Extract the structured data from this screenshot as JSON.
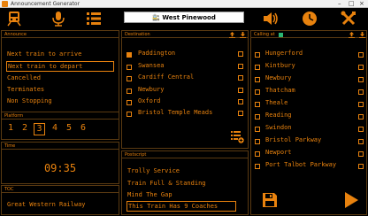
{
  "window": {
    "title": "Announcement Generator"
  },
  "toolbar": {
    "station": "West Pinewood"
  },
  "announce": {
    "header": "Announce",
    "items": [
      "Next train to arrive",
      "Next train to depart",
      "Cancelled",
      "Terminates",
      "Non Stopping"
    ],
    "selected_index": 1
  },
  "platform": {
    "header": "Platform",
    "numbers": [
      "1",
      "2",
      "3",
      "4",
      "5",
      "6"
    ],
    "selected": "3"
  },
  "time": {
    "header": "Time",
    "value": "09:35"
  },
  "toc": {
    "header": "TOC",
    "value": "Great Western Railway"
  },
  "destination": {
    "header": "Destination",
    "items": [
      "Paddington",
      "Swansea",
      "Cardiff Central",
      "Newbury",
      "Oxford",
      "Bristol Temple Meads"
    ],
    "selected_index": 0
  },
  "postscript": {
    "header": "Postscript",
    "items": [
      "Trolly Service",
      "Train Full & Standing",
      "Mind The Gap",
      "This Train Has 9 Coaches"
    ],
    "selected_index": 3
  },
  "calling": {
    "header": "Calling at",
    "items": [
      "Hungerford",
      "Kintbury",
      "Newbury",
      "Thatcham",
      "Theale",
      "Reading",
      "Swindon",
      "Bristol Parkway",
      "Newport",
      "Port Talbot Parkway"
    ]
  },
  "colors": {
    "accent": "#e8820e",
    "background": "#000000"
  }
}
